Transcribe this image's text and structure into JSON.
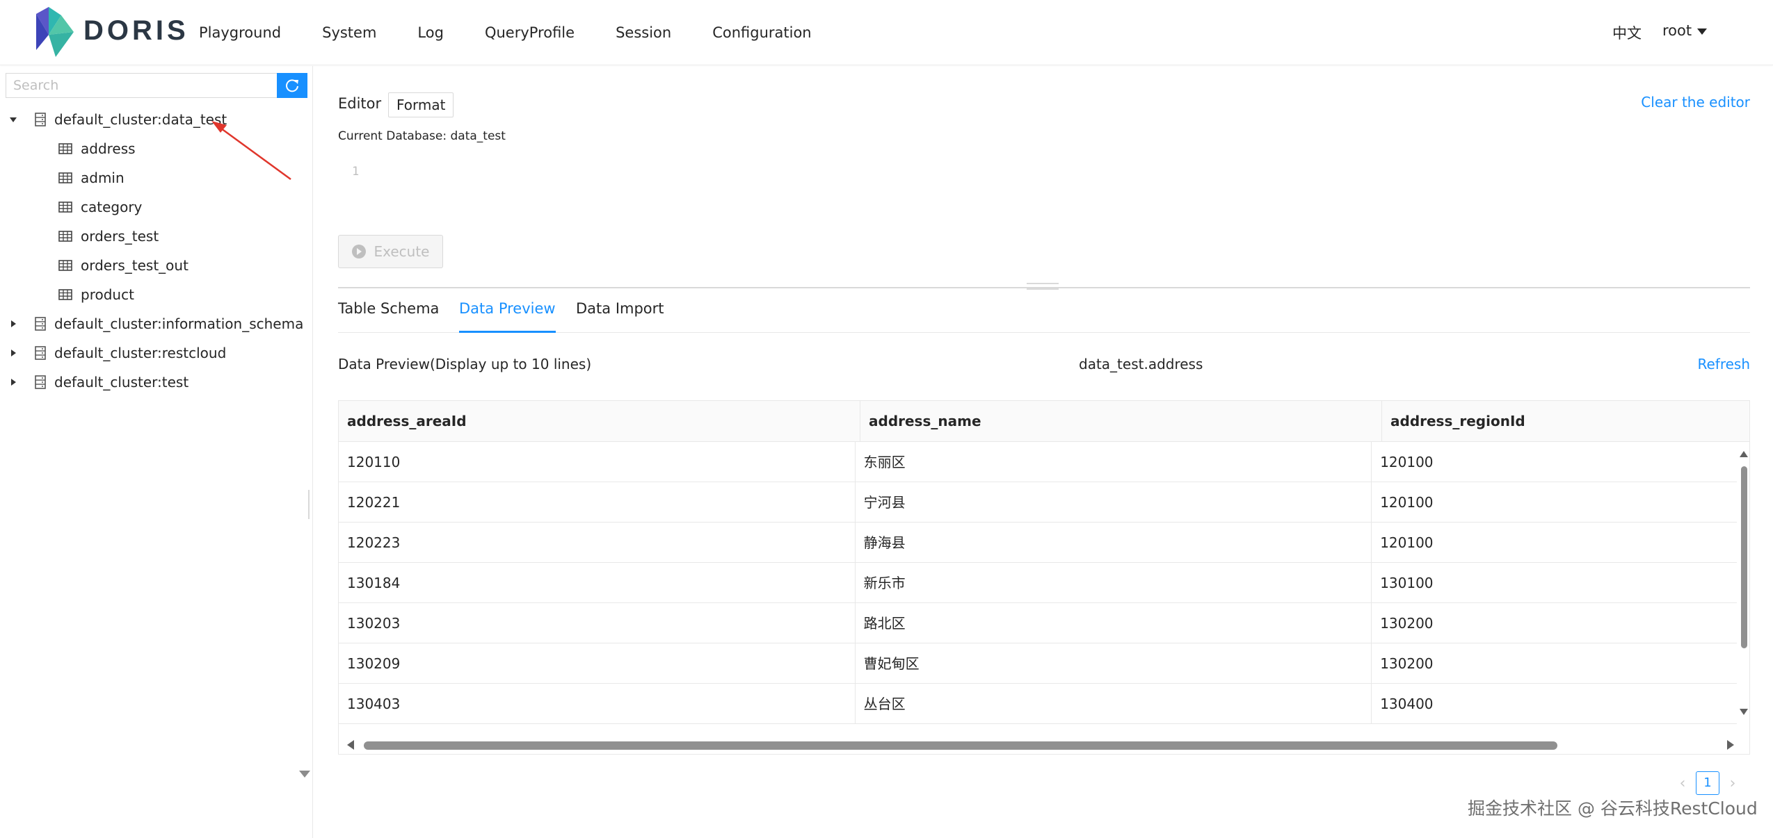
{
  "brand": {
    "name": "DORIS"
  },
  "nav": {
    "items": [
      "Playground",
      "System",
      "Log",
      "QueryProfile",
      "Session",
      "Configuration"
    ]
  },
  "header": {
    "lang": "中文",
    "user": "root"
  },
  "sidebar": {
    "search_placeholder": "Search",
    "tree": [
      {
        "label": "default_cluster:data_test",
        "expanded": true,
        "tables": [
          "address",
          "admin",
          "category",
          "orders_test",
          "orders_test_out",
          "product"
        ]
      },
      {
        "label": "default_cluster:information_schema",
        "expanded": false
      },
      {
        "label": "default_cluster:restcloud",
        "expanded": false
      },
      {
        "label": "default_cluster:test",
        "expanded": false
      }
    ]
  },
  "editor": {
    "label": "Editor",
    "format_label": "Format",
    "clear_label": "Clear the editor",
    "current_db": "Current Database: data_test",
    "line_number": "1",
    "execute_label": "Execute"
  },
  "tabs": [
    "Table Schema",
    "Data Preview",
    "Data Import"
  ],
  "active_tab": "Data Preview",
  "preview": {
    "title": "Data Preview(Display up to 10 lines)",
    "table_name": "data_test.address",
    "refresh_label": "Refresh",
    "columns": [
      "address_areaId",
      "address_name",
      "address_regionId"
    ],
    "rows": [
      [
        "120110",
        "东丽区",
        "120100"
      ],
      [
        "120221",
        "宁河县",
        "120100"
      ],
      [
        "120223",
        "静海县",
        "120100"
      ],
      [
        "130184",
        "新乐市",
        "130100"
      ],
      [
        "130203",
        "路北区",
        "130200"
      ],
      [
        "130209",
        "曹妃甸区",
        "130200"
      ],
      [
        "130403",
        "丛台区",
        "130400"
      ]
    ]
  },
  "pagination": {
    "current": "1",
    "prev": "‹",
    "next": "›"
  },
  "watermark": "掘金技术社区 @ 谷云科技RestCloud",
  "colors": {
    "accent": "#1890ff",
    "annotation_arrow": "#e0362c"
  }
}
